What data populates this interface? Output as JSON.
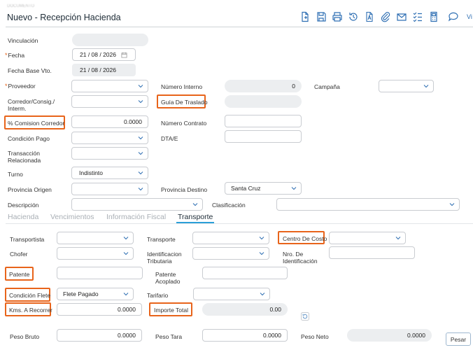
{
  "header": {
    "subtitle": "DOCUMENTO",
    "title": "Nuevo - Recepción Hacienda",
    "more_label": "Vi"
  },
  "toolbar_icons": [
    "new-document-icon",
    "save-icon",
    "print-icon",
    "history-icon",
    "pdf-icon",
    "attach-icon",
    "mail-icon",
    "checklist-icon",
    "calculator-icon",
    "comment-icon"
  ],
  "form": {
    "vinculacion": {
      "label": "Vinculación",
      "value": ""
    },
    "fecha": {
      "label": "Fecha",
      "value": "21 / 08 / 2026"
    },
    "fecha_base": {
      "label": "Fecha Base Vto.",
      "value": "21 / 08 / 2026"
    },
    "proveedor": {
      "label": "Proveedor",
      "value": ""
    },
    "numero_interno": {
      "label": "Número Interno",
      "value": "0"
    },
    "campana": {
      "label": "Campaña",
      "value": ""
    },
    "corredor": {
      "label_1": "Corredor/Consig./",
      "label_2": "Interm.",
      "value": ""
    },
    "guia_traslado": {
      "label": "Guía De Traslado",
      "value": ""
    },
    "comision": {
      "label": "% Comision Corredor",
      "value": "0.0000"
    },
    "numero_contrato": {
      "label": "Número Contrato",
      "value": ""
    },
    "condicion_pago": {
      "label": "Condición Pago",
      "value": ""
    },
    "dta": {
      "label": "DTA/E",
      "value": ""
    },
    "transaccion": {
      "label_1": "Transacción",
      "label_2": "Relacionada",
      "value": ""
    },
    "turno": {
      "label": "Turno",
      "value": "Indistinto"
    },
    "provincia_origen": {
      "label": "Provincia Origen",
      "value": ""
    },
    "provincia_destino": {
      "label": "Provincia Destino",
      "value": "Santa Cruz"
    },
    "descripcion": {
      "label": "Descripción",
      "value": ""
    },
    "clasificacion": {
      "label": "Clasificación",
      "value": ""
    }
  },
  "tabs": [
    {
      "label": "Hacienda",
      "active": false
    },
    {
      "label": "Vencimientos",
      "active": false
    },
    {
      "label": "Información Fiscal",
      "active": false
    },
    {
      "label": "Transporte",
      "active": true
    }
  ],
  "transporte": {
    "transportista": {
      "label": "Transportista",
      "value": ""
    },
    "transporte": {
      "label": "Transporte",
      "value": ""
    },
    "centro_costo": {
      "label": "Centro De Costo",
      "value": ""
    },
    "chofer": {
      "label": "Chofer",
      "value": ""
    },
    "identificacion_tributaria": {
      "label_1": "Identificacion",
      "label_2": "Tributaria",
      "value": ""
    },
    "nro_identificacion": {
      "label_1": "Nro. De",
      "label_2": "Identificación",
      "value": ""
    },
    "patente": {
      "label": "Patente",
      "value": ""
    },
    "patente_acoplado": {
      "label_1": "Patente",
      "label_2": "Acoplado",
      "value": ""
    },
    "condicion_flete": {
      "label": "Condición Flete",
      "value": "Flete Pagado"
    },
    "tarifario": {
      "label": "Tarifario",
      "value": ""
    },
    "kms_recorrer": {
      "label": "Kms. A Recorrer",
      "value": "0.0000"
    },
    "importe_total": {
      "label": "Importe Total",
      "value": "0.00"
    },
    "peso_bruto": {
      "label": "Peso Bruto",
      "value": "0.0000"
    },
    "peso_tara": {
      "label": "Peso Tara",
      "value": "0.0000"
    },
    "peso_neto": {
      "label": "Peso Neto",
      "value": "0.0000"
    },
    "pesar_label": "Pesar"
  },
  "colors": {
    "accent": "#e8641b",
    "tab_underline": "#2b9fd8",
    "icon": "#2f6fb3"
  }
}
